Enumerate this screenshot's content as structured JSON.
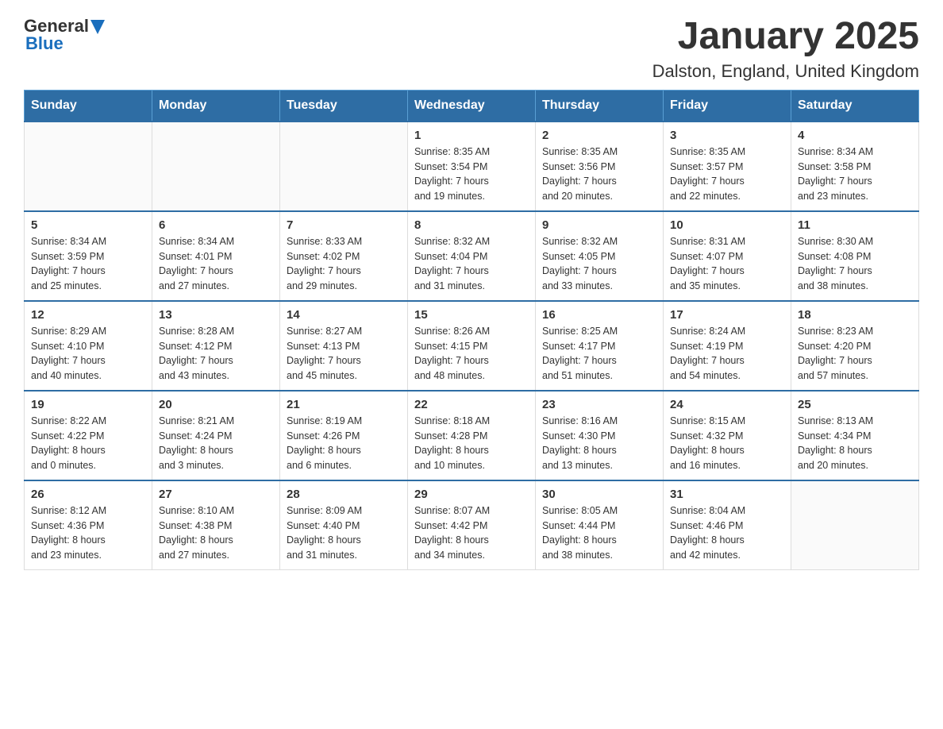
{
  "header": {
    "logo": {
      "text_general": "General",
      "text_blue": "Blue",
      "triangle": "▼"
    },
    "title": "January 2025",
    "subtitle": "Dalston, England, United Kingdom"
  },
  "weekdays": [
    "Sunday",
    "Monday",
    "Tuesday",
    "Wednesday",
    "Thursday",
    "Friday",
    "Saturday"
  ],
  "weeks": [
    [
      {
        "day": "",
        "info": ""
      },
      {
        "day": "",
        "info": ""
      },
      {
        "day": "",
        "info": ""
      },
      {
        "day": "1",
        "info": "Sunrise: 8:35 AM\nSunset: 3:54 PM\nDaylight: 7 hours\nand 19 minutes."
      },
      {
        "day": "2",
        "info": "Sunrise: 8:35 AM\nSunset: 3:56 PM\nDaylight: 7 hours\nand 20 minutes."
      },
      {
        "day": "3",
        "info": "Sunrise: 8:35 AM\nSunset: 3:57 PM\nDaylight: 7 hours\nand 22 minutes."
      },
      {
        "day": "4",
        "info": "Sunrise: 8:34 AM\nSunset: 3:58 PM\nDaylight: 7 hours\nand 23 minutes."
      }
    ],
    [
      {
        "day": "5",
        "info": "Sunrise: 8:34 AM\nSunset: 3:59 PM\nDaylight: 7 hours\nand 25 minutes."
      },
      {
        "day": "6",
        "info": "Sunrise: 8:34 AM\nSunset: 4:01 PM\nDaylight: 7 hours\nand 27 minutes."
      },
      {
        "day": "7",
        "info": "Sunrise: 8:33 AM\nSunset: 4:02 PM\nDaylight: 7 hours\nand 29 minutes."
      },
      {
        "day": "8",
        "info": "Sunrise: 8:32 AM\nSunset: 4:04 PM\nDaylight: 7 hours\nand 31 minutes."
      },
      {
        "day": "9",
        "info": "Sunrise: 8:32 AM\nSunset: 4:05 PM\nDaylight: 7 hours\nand 33 minutes."
      },
      {
        "day": "10",
        "info": "Sunrise: 8:31 AM\nSunset: 4:07 PM\nDaylight: 7 hours\nand 35 minutes."
      },
      {
        "day": "11",
        "info": "Sunrise: 8:30 AM\nSunset: 4:08 PM\nDaylight: 7 hours\nand 38 minutes."
      }
    ],
    [
      {
        "day": "12",
        "info": "Sunrise: 8:29 AM\nSunset: 4:10 PM\nDaylight: 7 hours\nand 40 minutes."
      },
      {
        "day": "13",
        "info": "Sunrise: 8:28 AM\nSunset: 4:12 PM\nDaylight: 7 hours\nand 43 minutes."
      },
      {
        "day": "14",
        "info": "Sunrise: 8:27 AM\nSunset: 4:13 PM\nDaylight: 7 hours\nand 45 minutes."
      },
      {
        "day": "15",
        "info": "Sunrise: 8:26 AM\nSunset: 4:15 PM\nDaylight: 7 hours\nand 48 minutes."
      },
      {
        "day": "16",
        "info": "Sunrise: 8:25 AM\nSunset: 4:17 PM\nDaylight: 7 hours\nand 51 minutes."
      },
      {
        "day": "17",
        "info": "Sunrise: 8:24 AM\nSunset: 4:19 PM\nDaylight: 7 hours\nand 54 minutes."
      },
      {
        "day": "18",
        "info": "Sunrise: 8:23 AM\nSunset: 4:20 PM\nDaylight: 7 hours\nand 57 minutes."
      }
    ],
    [
      {
        "day": "19",
        "info": "Sunrise: 8:22 AM\nSunset: 4:22 PM\nDaylight: 8 hours\nand 0 minutes."
      },
      {
        "day": "20",
        "info": "Sunrise: 8:21 AM\nSunset: 4:24 PM\nDaylight: 8 hours\nand 3 minutes."
      },
      {
        "day": "21",
        "info": "Sunrise: 8:19 AM\nSunset: 4:26 PM\nDaylight: 8 hours\nand 6 minutes."
      },
      {
        "day": "22",
        "info": "Sunrise: 8:18 AM\nSunset: 4:28 PM\nDaylight: 8 hours\nand 10 minutes."
      },
      {
        "day": "23",
        "info": "Sunrise: 8:16 AM\nSunset: 4:30 PM\nDaylight: 8 hours\nand 13 minutes."
      },
      {
        "day": "24",
        "info": "Sunrise: 8:15 AM\nSunset: 4:32 PM\nDaylight: 8 hours\nand 16 minutes."
      },
      {
        "day": "25",
        "info": "Sunrise: 8:13 AM\nSunset: 4:34 PM\nDaylight: 8 hours\nand 20 minutes."
      }
    ],
    [
      {
        "day": "26",
        "info": "Sunrise: 8:12 AM\nSunset: 4:36 PM\nDaylight: 8 hours\nand 23 minutes."
      },
      {
        "day": "27",
        "info": "Sunrise: 8:10 AM\nSunset: 4:38 PM\nDaylight: 8 hours\nand 27 minutes."
      },
      {
        "day": "28",
        "info": "Sunrise: 8:09 AM\nSunset: 4:40 PM\nDaylight: 8 hours\nand 31 minutes."
      },
      {
        "day": "29",
        "info": "Sunrise: 8:07 AM\nSunset: 4:42 PM\nDaylight: 8 hours\nand 34 minutes."
      },
      {
        "day": "30",
        "info": "Sunrise: 8:05 AM\nSunset: 4:44 PM\nDaylight: 8 hours\nand 38 minutes."
      },
      {
        "day": "31",
        "info": "Sunrise: 8:04 AM\nSunset: 4:46 PM\nDaylight: 8 hours\nand 42 minutes."
      },
      {
        "day": "",
        "info": ""
      }
    ]
  ]
}
